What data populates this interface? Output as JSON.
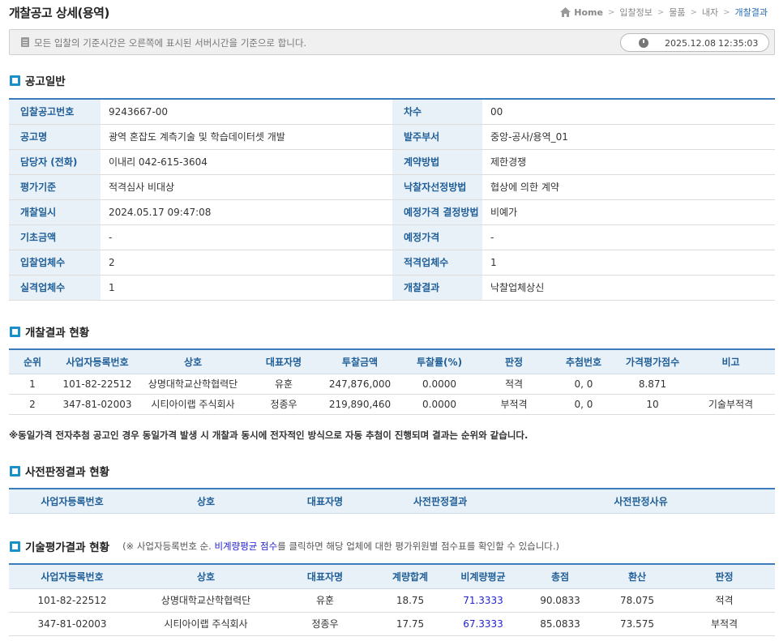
{
  "page_title": "개찰공고 상세(용역)",
  "breadcrumb": [
    "Home",
    "입찰정보",
    "물품",
    "내자",
    "개찰결과"
  ],
  "notice": {
    "text": "모든 입찰의 기준시간은 오른쪽에 표시된 서버시간을 기준으로 합니다.",
    "server_date": "2025.12.08",
    "server_time": "12:35:03"
  },
  "sections": {
    "general": "공고일반",
    "results": "개찰결과 현황",
    "prejudge": "사전판정결과 현황",
    "tech": "기술평가결과 현황"
  },
  "general_info": [
    {
      "label": "입찰공고번호",
      "value": "9243667-00",
      "label2": "차수",
      "value2": "00"
    },
    {
      "label": "공고명",
      "value": "광역 혼잡도 계측기술 및 학습데이터셋 개발",
      "label2": "발주부서",
      "value2": "중앙-공사/용역_01"
    },
    {
      "label": "담당자 (전화)",
      "value": "이내리 042-615-3604",
      "label2": "계약방법",
      "value2": "제한경쟁"
    },
    {
      "label": "평가기준",
      "value": "적격심사 비대상",
      "label2": "낙찰자선정방법",
      "value2": "협상에 의한 계약"
    },
    {
      "label": "개찰일시",
      "value": "2024.05.17 09:47:08",
      "label2": "예정가격 결정방법",
      "value2": "비예가"
    },
    {
      "label": "기초금액",
      "value": "-",
      "label2": "예정가격",
      "value2": "-"
    },
    {
      "label": "입찰업체수",
      "value": "2",
      "label2": "적격업체수",
      "value2": "1"
    },
    {
      "label": "실격업체수",
      "value": "1",
      "label2": "개찰결과",
      "value2": "낙찰업체상신"
    }
  ],
  "results_table": {
    "headers": [
      "순위",
      "사업자등록번호",
      "상호",
      "대표자명",
      "투찰금액",
      "투찰률(%)",
      "판정",
      "추첨번호",
      "가격평가점수",
      "비고"
    ],
    "rows": [
      [
        "1",
        "101-82-22512",
        "상명대학교산학협력단",
        "유훈",
        "247,876,000",
        "0.0000",
        "적격",
        "0, 0",
        "8.871",
        ""
      ],
      [
        "2",
        "347-81-02003",
        "시티아이랩 주식회사",
        "정종우",
        "219,890,460",
        "0.0000",
        "부적격",
        "0, 0",
        "10",
        "기술부적격"
      ]
    ]
  },
  "footnote": "※동일가격 전자추첨 공고인 경우 동일가격 발생 시 개찰과 동시에 전자적인 방식으로 자동 추첨이 진행되며 결과는 순위와 같습니다.",
  "prejudge_table": {
    "headers": [
      "사업자등록번호",
      "상호",
      "대표자명",
      "사전판정결과",
      "사전판정사유"
    ]
  },
  "tech_note": {
    "prefix": "(※ 사업자등록번호 순.",
    "link": "비계량평균 점수",
    "suffix": "를 클릭하면 해당 업체에 대한 평가위원별 점수표를 확인할 수 있습니다.)"
  },
  "tech_table": {
    "headers": [
      "사업자등록번호",
      "상호",
      "대표자명",
      "계량합계",
      "비계량평균",
      "총점",
      "환산",
      "판정"
    ],
    "rows": [
      [
        "101-82-22512",
        "상명대학교산학협력단",
        "유훈",
        "18.75",
        "71.3333",
        "90.0833",
        "78.075",
        "적격"
      ],
      [
        "347-81-02003",
        "시티아이랩 주식회사",
        "정종우",
        "17.75",
        "67.3333",
        "85.0833",
        "73.575",
        "부적격"
      ]
    ]
  }
}
